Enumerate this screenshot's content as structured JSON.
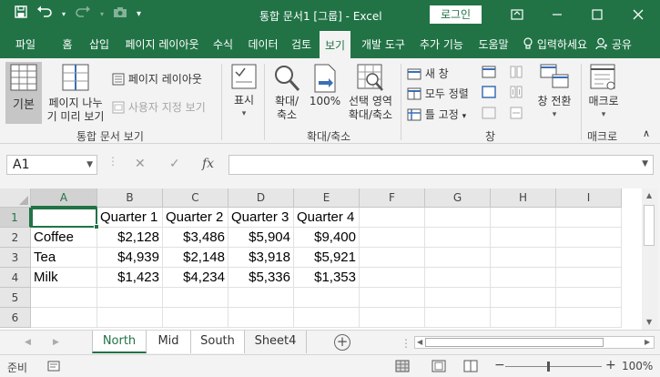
{
  "window": {
    "title": "통합 문서1 [그룹] - Excel",
    "login_label": "로그인"
  },
  "tabs": [
    {
      "label": "파일"
    },
    {
      "label": "홈"
    },
    {
      "label": "삽입"
    },
    {
      "label": "페이지 레이아웃"
    },
    {
      "label": "수식"
    },
    {
      "label": "데이터"
    },
    {
      "label": "검토"
    },
    {
      "label": "보기",
      "active": true
    },
    {
      "label": "개발 도구"
    },
    {
      "label": "추가 기능"
    },
    {
      "label": "도움말"
    },
    {
      "label": "입력하세요"
    },
    {
      "label": "공유"
    }
  ],
  "ribbon": {
    "normal_label": "기본",
    "page_break_label1": "페이지 나누",
    "page_break_label2": "기 미리 보기",
    "page_layout_label": "페이지 레이아웃",
    "custom_view_label": "사용자 지정 보기",
    "workbook_views_group": "통합 문서 보기",
    "show_label": "표시",
    "zoom_label1": "확대/",
    "zoom_label2": "축소",
    "zoom100_label": "100%",
    "zoom_selection_label1": "선택 영역",
    "zoom_selection_label2": "확대/축소",
    "zoom_group": "확대/축소",
    "new_window_label": "새 창",
    "arrange_all_label": "모두 정렬",
    "freeze_panes_label": "틀 고정",
    "switch_windows_label": "창 전환",
    "window_group": "창",
    "macros_label": "매크로",
    "macros_group": "매크로"
  },
  "formula_bar": {
    "name_box": "A1",
    "fx": "fx",
    "value": ""
  },
  "columns": [
    "A",
    "B",
    "C",
    "D",
    "E",
    "F",
    "G",
    "H",
    "I"
  ],
  "rows": [
    "1",
    "2",
    "3",
    "4",
    "5",
    "6"
  ],
  "cells": {
    "B1": "Quarter 1",
    "C1": "Quarter 2",
    "D1": "Quarter 3",
    "E1": "Quarter 4",
    "A2": "Coffee",
    "B2": "$2,128",
    "C2": "$3,486",
    "D2": "$5,904",
    "E2": "$9,400",
    "A3": "Tea",
    "B3": "$4,939",
    "C3": "$2,148",
    "D3": "$3,918",
    "E3": "$5,921",
    "A4": "Milk",
    "B4": "$1,423",
    "C4": "$4,234",
    "D4": "$5,336",
    "E4": "$1,353"
  },
  "sheets": [
    {
      "name": "North",
      "active": true
    },
    {
      "name": "Mid",
      "active": true
    },
    {
      "name": "South",
      "active": true
    },
    {
      "name": "Sheet4",
      "active": false
    }
  ],
  "status": {
    "ready": "준비",
    "zoom": "100%"
  },
  "colors": {
    "accent": "#217346",
    "ribbon_bg": "#f3f3f3"
  }
}
